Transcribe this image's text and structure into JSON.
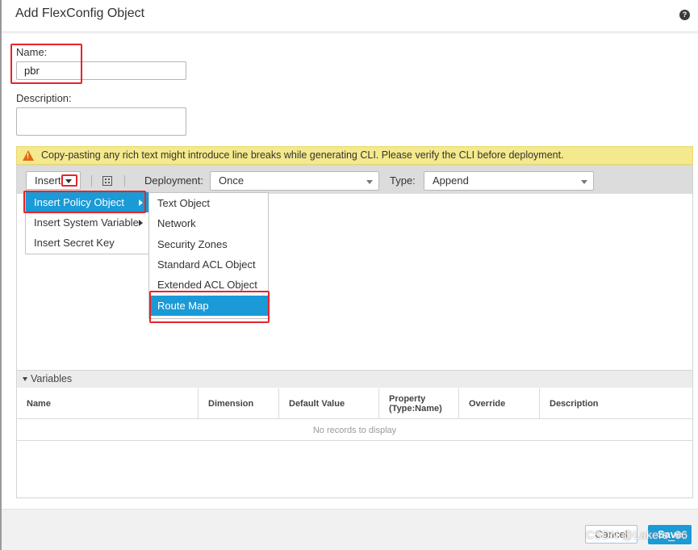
{
  "dialog": {
    "title": "Add FlexConfig Object",
    "help_icon": "?"
  },
  "form": {
    "name_label": "Name:",
    "name_value": "pbr",
    "description_label": "Description:",
    "description_value": ""
  },
  "warning": {
    "icon": "warning-triangle-icon",
    "text": "Copy-pasting any rich text might introduce line breaks while generating CLI. Please verify the CLI before deployment."
  },
  "toolbar": {
    "insert_label": "Insert",
    "deployment_label": "Deployment:",
    "deployment_value": "Once",
    "type_label": "Type:",
    "type_value": "Append"
  },
  "insert_menu": {
    "items": [
      {
        "label": "Insert Policy Object",
        "active": true
      },
      {
        "label": "Insert System Variable",
        "active": false
      },
      {
        "label": "Insert Secret Key",
        "active": false
      }
    ]
  },
  "policy_object_menu": {
    "items": [
      {
        "label": "Text Object",
        "active": false
      },
      {
        "label": "Network",
        "active": false
      },
      {
        "label": "Security Zones",
        "active": false
      },
      {
        "label": "Standard ACL Object",
        "active": false
      },
      {
        "label": "Extended ACL Object",
        "active": false
      },
      {
        "label": "Route Map",
        "active": true
      }
    ]
  },
  "variables": {
    "title": "Variables",
    "columns": [
      "Name",
      "Dimension",
      "Default Value",
      "Property (Type:Name)",
      "Override",
      "Description"
    ],
    "empty_text": "No records to display"
  },
  "footer": {
    "cancel_label": "Cancel",
    "save_label": "Save"
  },
  "watermark": "CSDN @Lakers_66",
  "colors": {
    "accent": "#1a9ad6",
    "highlight_box": "#e8232a",
    "warning_bg": "#f4e98c"
  }
}
